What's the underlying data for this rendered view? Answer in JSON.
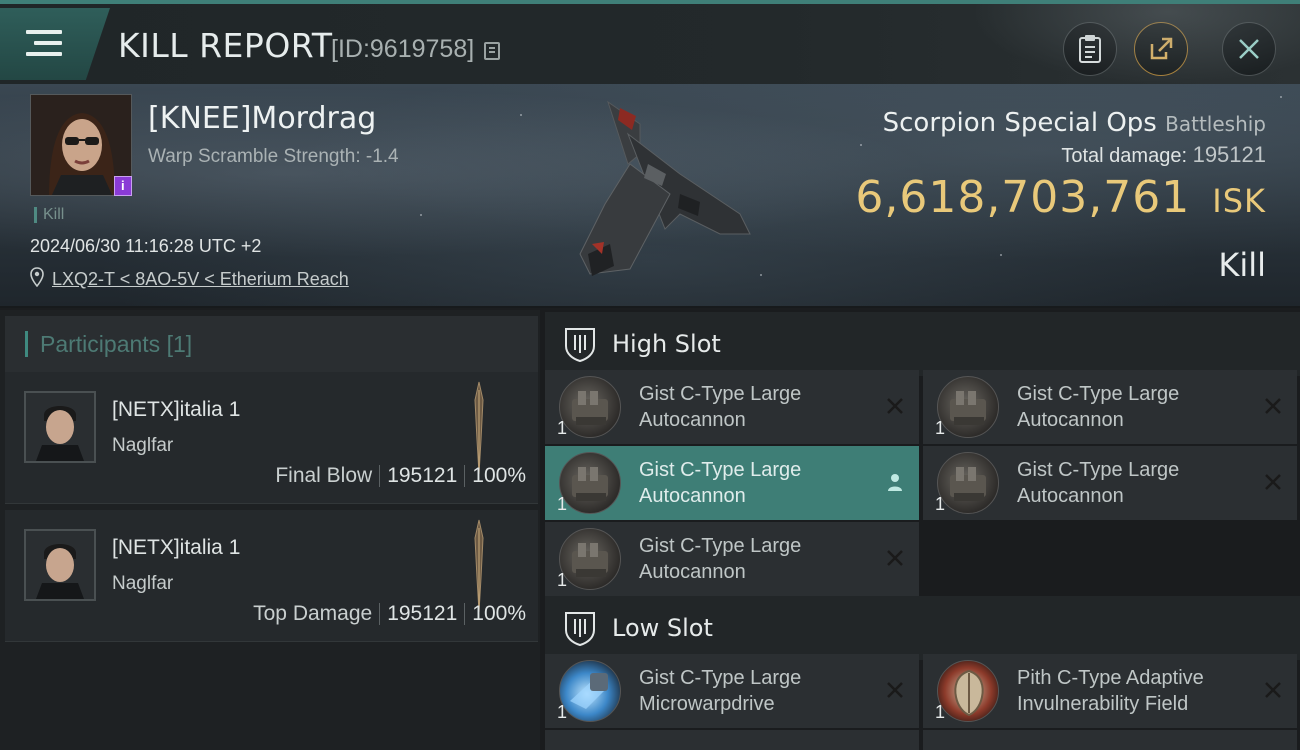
{
  "header": {
    "title": "KILL REPORT",
    "report_id": "[ID:9619758]",
    "buttons": {
      "clipboard_icon": "clipboard-icon",
      "share_icon": "share-icon",
      "close_icon": "close-icon"
    }
  },
  "victim": {
    "name": "[KNEE]Mordrag",
    "warp_scramble": "Warp Scramble Strength: -1.4",
    "kill_tag": "Kill",
    "datetime": "2024/06/30 11:16:28 UTC +2",
    "location": "LXQ2-T < 8AO-5V < Etherium Reach",
    "ship_name": "Scorpion Special Ops",
    "ship_class": "Battleship",
    "total_damage_label": "Total damage:",
    "total_damage": "195121",
    "isk_value": "6,618,703,761",
    "isk_unit": "ISK",
    "result": "Kill"
  },
  "participants": {
    "title": "Participants",
    "count": "[1]",
    "items": [
      {
        "name": "[NETX]italia 1",
        "ship": "Naglfar",
        "role": "Final Blow",
        "damage": "195121",
        "percent": "100%"
      },
      {
        "name": "[NETX]italia 1",
        "ship": "Naglfar",
        "role": "Top Damage",
        "damage": "195121",
        "percent": "100%"
      }
    ]
  },
  "slots": {
    "high": {
      "title": "High Slot",
      "modules": [
        {
          "qty": "1",
          "line1": "Gist C-Type Large",
          "line2": "Autocannon",
          "status": "destroyed"
        },
        {
          "qty": "1",
          "line1": "Gist C-Type Large",
          "line2": "Autocannon",
          "status": "destroyed"
        },
        {
          "qty": "1",
          "line1": "Gist C-Type Large",
          "line2": "Autocannon",
          "status": "dropped"
        },
        {
          "qty": "1",
          "line1": "Gist C-Type Large",
          "line2": "Autocannon",
          "status": "destroyed"
        },
        {
          "qty": "1",
          "line1": "Gist C-Type Large",
          "line2": "Autocannon",
          "status": "destroyed"
        }
      ]
    },
    "low": {
      "title": "Low Slot",
      "modules": [
        {
          "qty": "1",
          "line1": "Gist C-Type Large",
          "line2": "Microwarpdrive",
          "status": "destroyed"
        },
        {
          "qty": "1",
          "line1": "Pith C-Type Adaptive",
          "line2": "Invulnerability Field",
          "status": "destroyed"
        }
      ]
    }
  },
  "colors": {
    "accent_teal": "#3e7e76",
    "isk_gold": "#e9c97a",
    "badge_purple": "#8a3bd6"
  }
}
